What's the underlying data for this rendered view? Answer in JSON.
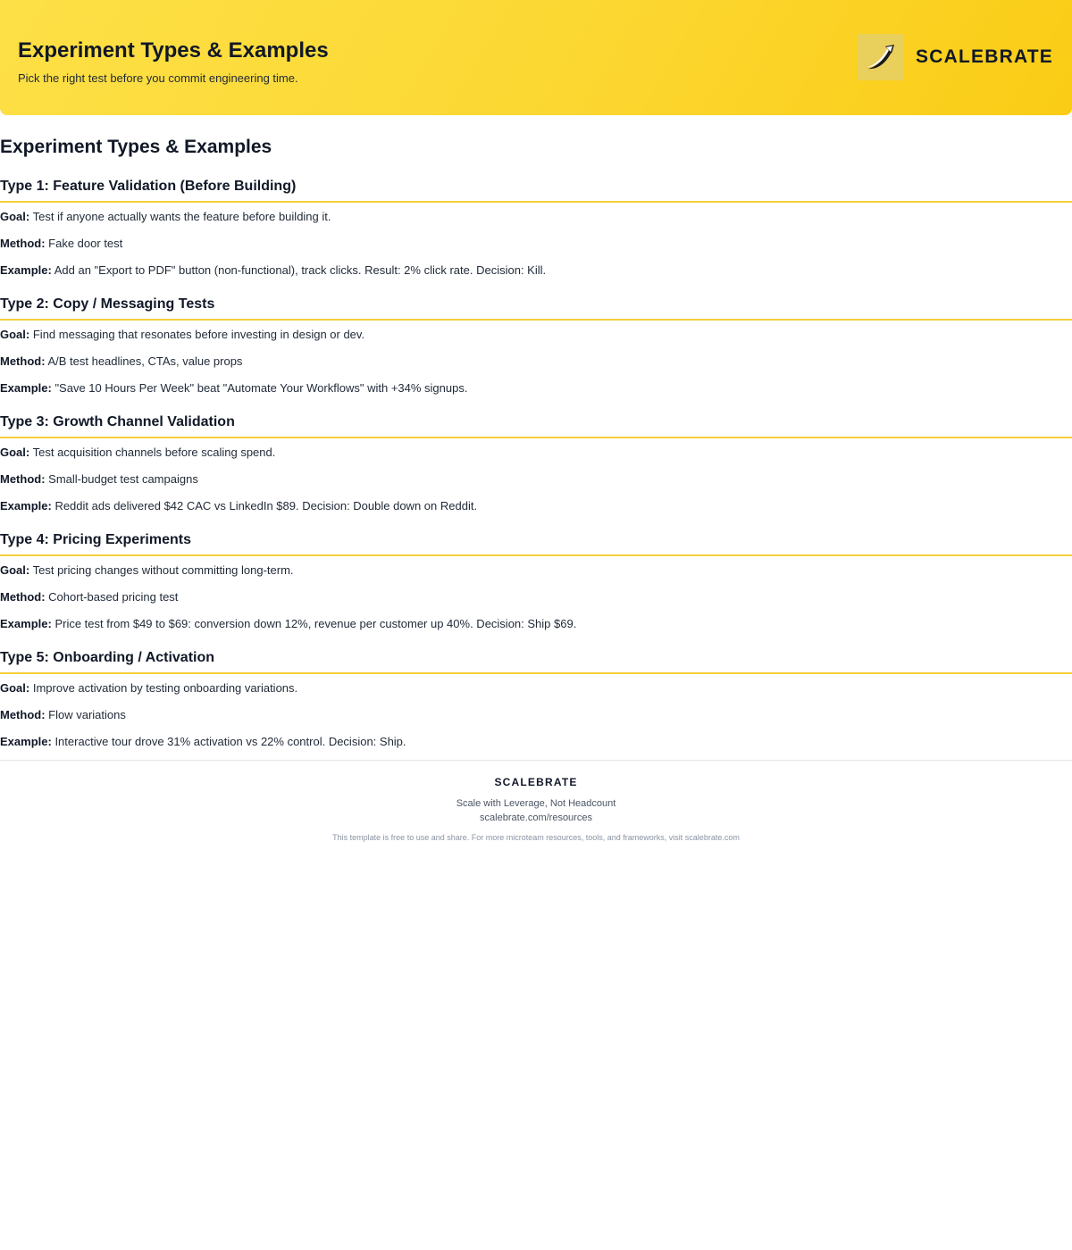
{
  "header": {
    "title": "Experiment Types & Examples",
    "subtitle": "Pick the right test before you commit engineering time.",
    "brand": "SCALEBRATE",
    "logo_icon": "rising-arrow-icon"
  },
  "document": {
    "title": "Experiment Types & Examples",
    "field_labels": {
      "goal": "Goal:",
      "method": "Method:",
      "example": "Example:"
    },
    "sections": [
      {
        "heading": "Type 1: Feature Validation (Before Building)",
        "goal": "Test if anyone actually wants the feature before building it.",
        "method": "Fake door test",
        "example": "Add an \"Export to PDF\" button (non-functional), track clicks. Result: 2% click rate. Decision: Kill."
      },
      {
        "heading": "Type 2: Copy / Messaging Tests",
        "goal": "Find messaging that resonates before investing in design or dev.",
        "method": "A/B test headlines, CTAs, value props",
        "example": "\"Save 10 Hours Per Week\" beat \"Automate Your Workflows\" with +34% signups."
      },
      {
        "heading": "Type 3: Growth Channel Validation",
        "goal": "Test acquisition channels before scaling spend.",
        "method": "Small-budget test campaigns",
        "example": "Reddit ads delivered $42 CAC vs LinkedIn $89. Decision: Double down on Reddit."
      },
      {
        "heading": "Type 4: Pricing Experiments",
        "goal": "Test pricing changes without committing long-term.",
        "method": "Cohort-based pricing test",
        "example": "Price test from $49 to $69: conversion down 12%, revenue per customer up 40%. Decision: Ship $69."
      },
      {
        "heading": "Type 5: Onboarding / Activation",
        "goal": "Improve activation by testing onboarding variations.",
        "method": "Flow variations",
        "example": "Interactive tour drove 31% activation vs 22% control. Decision: Ship."
      }
    ]
  },
  "footer": {
    "brand": "SCALEBRATE",
    "tagline": "Scale with Leverage, Not Headcount",
    "url": "scalebrate.com/resources",
    "note": "This template is free to use and share. For more microteam resources, tools, and frameworks, visit scalebrate.com"
  },
  "colors": {
    "header_gradient_start": "#fde047",
    "header_gradient_end": "#facc15",
    "section_rule": "#f3d03a",
    "text": "#111827"
  }
}
